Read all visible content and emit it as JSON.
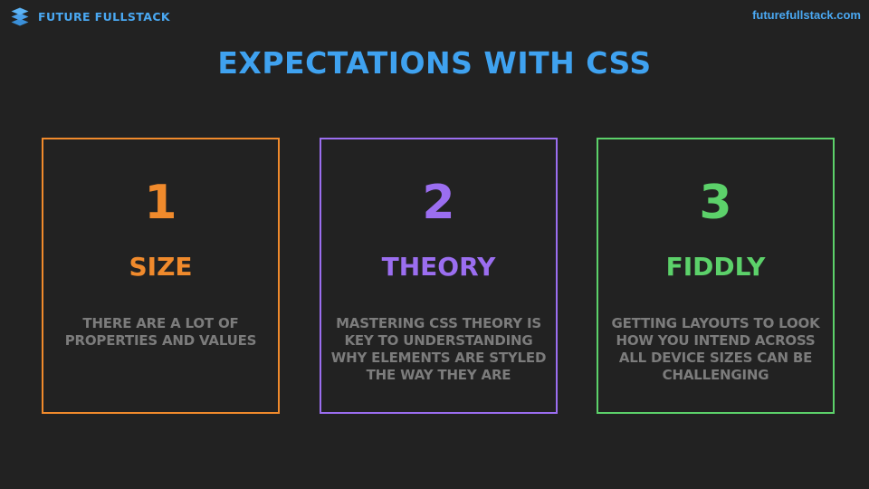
{
  "header": {
    "brand_name": "FUTURE FULLSTACK",
    "brand_icon": "layers-stack-icon",
    "site_link": "futurefullstack.com"
  },
  "title": "EXPECTATIONS WITH CSS",
  "colors": {
    "background": "#222222",
    "brand_blue": "#3fa2f0",
    "card_1": "#f08a2c",
    "card_2": "#9b6ef0",
    "card_3": "#5cd16a",
    "description_gray": "#7c7c7c"
  },
  "cards": [
    {
      "number": "1",
      "heading": "SIZE",
      "description": "THERE ARE A LOT OF PROPERTIES AND VALUES"
    },
    {
      "number": "2",
      "heading": "THEORY",
      "description": "MASTERING CSS THEORY IS KEY TO UNDERSTANDING WHY ELEMENTS ARE STYLED THE WAY THEY ARE"
    },
    {
      "number": "3",
      "heading": "FIDDLY",
      "description": "GETTING LAYOUTS TO LOOK HOW YOU INTEND ACROSS ALL DEVICE SIZES CAN BE CHALLENGING"
    }
  ]
}
